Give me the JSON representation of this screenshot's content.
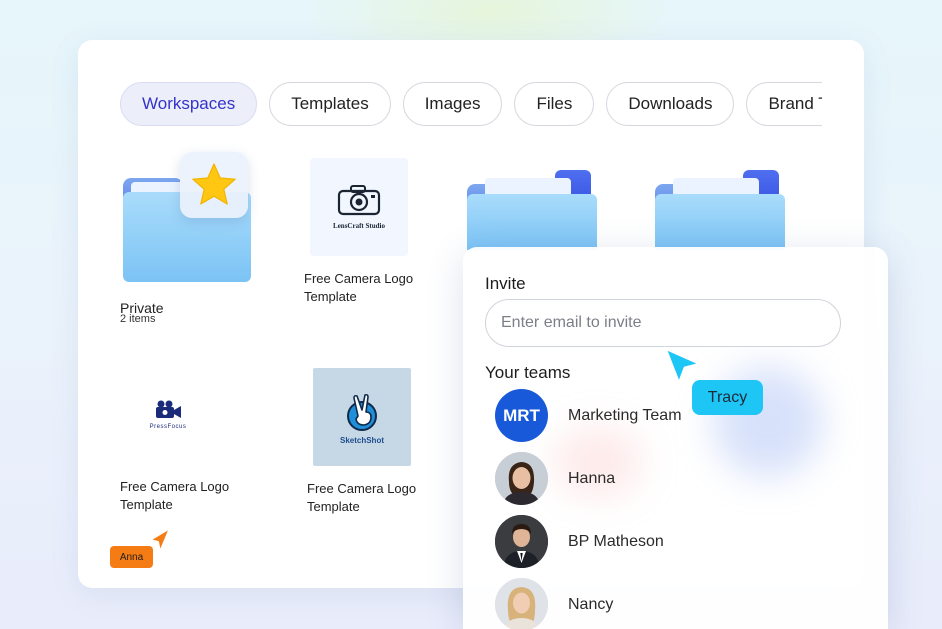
{
  "tabs": [
    {
      "label": "Workspaces",
      "active": true
    },
    {
      "label": "Templates",
      "active": false
    },
    {
      "label": "Images",
      "active": false
    },
    {
      "label": "Files",
      "active": false
    },
    {
      "label": "Downloads",
      "active": false
    },
    {
      "label": "Brand Templates",
      "active": false
    }
  ],
  "items": {
    "private_folder": {
      "title": "Private",
      "count": "2 items",
      "badge_icon": "star-icon"
    },
    "lenscraft": {
      "logo_text": "LensCraft Studio",
      "caption_line1": "Free Camera Logo",
      "caption_line2": "Template"
    },
    "pressfocus": {
      "logo_text": "PressFocus",
      "caption_line1": "Free Camera Logo",
      "caption_line2": "Template"
    },
    "sketchshot": {
      "logo_text": "SketchShot",
      "caption_line1": "Free Camera Logo",
      "caption_line2": "Template"
    }
  },
  "invite": {
    "title": "Invite",
    "input_placeholder": "Enter email to invite",
    "teams_title": "Your teams",
    "teams": [
      {
        "name": "Marketing Team",
        "initials": "MRT"
      },
      {
        "name": "Hanna",
        "initials": ""
      },
      {
        "name": "BP Matheson",
        "initials": ""
      },
      {
        "name": "Nancy",
        "initials": ""
      }
    ]
  },
  "cursors": [
    {
      "name": "Tracy",
      "color": "#1ec6f5"
    },
    {
      "name": "Anna",
      "color": "#f57c14"
    }
  ],
  "colors": {
    "accent": "#3433c9",
    "folder_blue": "#7cc3f5",
    "team_avatar": "#1759d8",
    "star": "#ffc712"
  }
}
